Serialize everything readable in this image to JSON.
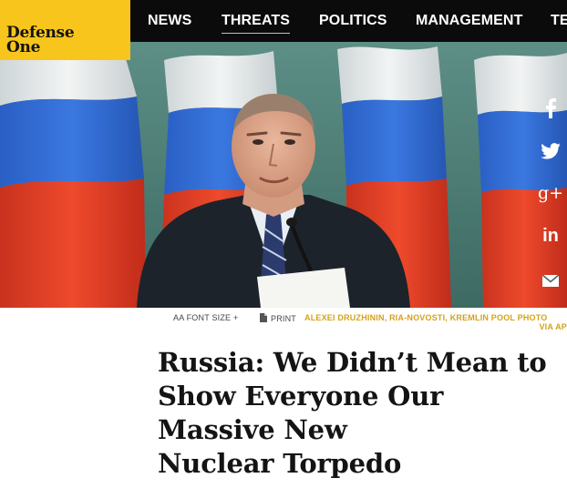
{
  "logo": {
    "line1": "Defense",
    "line2": "One"
  },
  "nav": {
    "items": [
      {
        "label": "NEWS",
        "active": false
      },
      {
        "label": "THREATS",
        "active": true
      },
      {
        "label": "POLITICS",
        "active": false
      },
      {
        "label": "MANAGEMENT",
        "active": false
      },
      {
        "label": "TE",
        "active": false
      }
    ]
  },
  "share": {
    "icons": [
      "facebook-icon",
      "twitter-icon",
      "google-plus-icon",
      "linkedin-icon",
      "email-icon"
    ],
    "glyphs": [
      "f",
      "",
      "g+",
      "in",
      ""
    ]
  },
  "caption": {
    "font_size_label": "AA FONT SIZE +",
    "print_label": "PRINT",
    "credit_line1": "ALEXEI DRUZHININ, RIA-NOVOSTI, KREMLIN POOL PHOTO",
    "credit_line2": "VIA AP"
  },
  "article": {
    "title_lines": [
      "Russia: We Didn’t Mean to",
      "Show Everyone Our",
      "Massive New",
      "Nuclear Torpedo"
    ]
  },
  "colors": {
    "brand_yellow": "#f7c51c",
    "nav_bg": "#0b0b0b",
    "credit": "#d4a21a",
    "flag_blue": "#2f6bd1",
    "flag_red": "#e2412a"
  }
}
